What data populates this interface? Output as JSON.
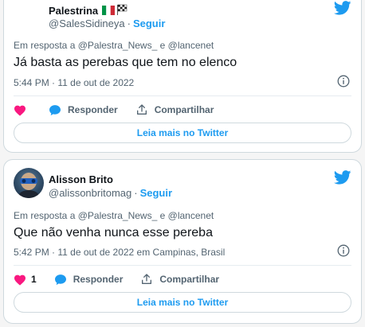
{
  "tweets": [
    {
      "name": "Palestrina",
      "handle": "@SalesSidineya",
      "follow_label": "Seguir",
      "separator": "·",
      "reply_prefix": "Em resposta a",
      "reply_user1": "@Palestra_News_",
      "reply_conj": "e",
      "reply_user2": "@lancenet",
      "text": "Já basta as perebas que tem no elenco",
      "meta": "5:44 PM · 11 de out de 2022",
      "like_count": "",
      "reply_label": "Responder",
      "share_label": "Compartilhar",
      "read_more_label": "Leia mais no Twitter"
    },
    {
      "name": "Alisson Brito",
      "handle": "@alissonbritomag",
      "follow_label": "Seguir",
      "separator": "·",
      "reply_prefix": "Em resposta a",
      "reply_user1": "@Palestra_News_",
      "reply_conj": "e",
      "reply_user2": "@lancenet",
      "text": "Que não venha nunca esse pereba",
      "meta": "5:42 PM · 11 de out de 2022 em Campinas, Brasil",
      "like_count": "1",
      "reply_label": "Responder",
      "share_label": "Compartilhar",
      "read_more_label": "Leia mais no Twitter"
    }
  ],
  "colors": {
    "twitter_blue": "#1d9bf0",
    "like_pink": "#f91880",
    "secondary_text": "#536471",
    "border": "#cfd9de"
  },
  "icons": [
    "twitter-bird-icon",
    "info-icon",
    "heart-icon",
    "reply-bubble-icon",
    "share-icon",
    "italy-flag-icon",
    "checkered-flag-icon"
  ]
}
